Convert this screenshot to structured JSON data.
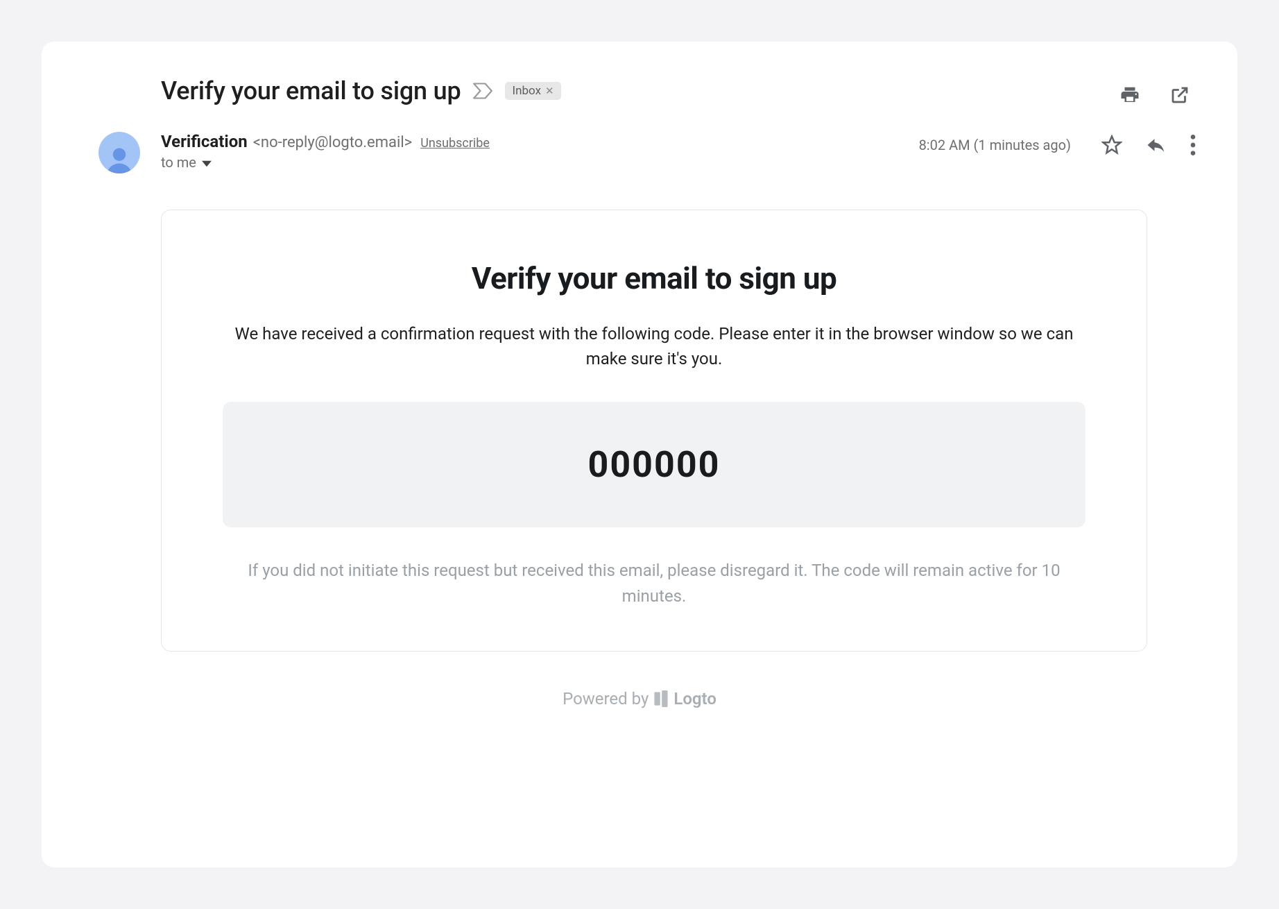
{
  "header": {
    "subject": "Verify your email to sign up",
    "inbox_label": "Inbox"
  },
  "sender": {
    "name": "Verification",
    "email": "<no-reply@logto.email>",
    "unsubscribe_label": "Unsubscribe",
    "recipient_line": "to me"
  },
  "meta": {
    "timestamp": "8:02 AM (1 minutes ago)"
  },
  "body": {
    "title": "Verify your email to sign up",
    "intro": "We have received a confirmation request with the following code. Please enter it in the browser window so we can make sure it's you.",
    "code": "000000",
    "disclaimer": "If you did not initiate this request but received this email, please disregard it. The code will remain active for 10 minutes."
  },
  "footer": {
    "powered_by": "Powered by",
    "brand": "Logto"
  }
}
